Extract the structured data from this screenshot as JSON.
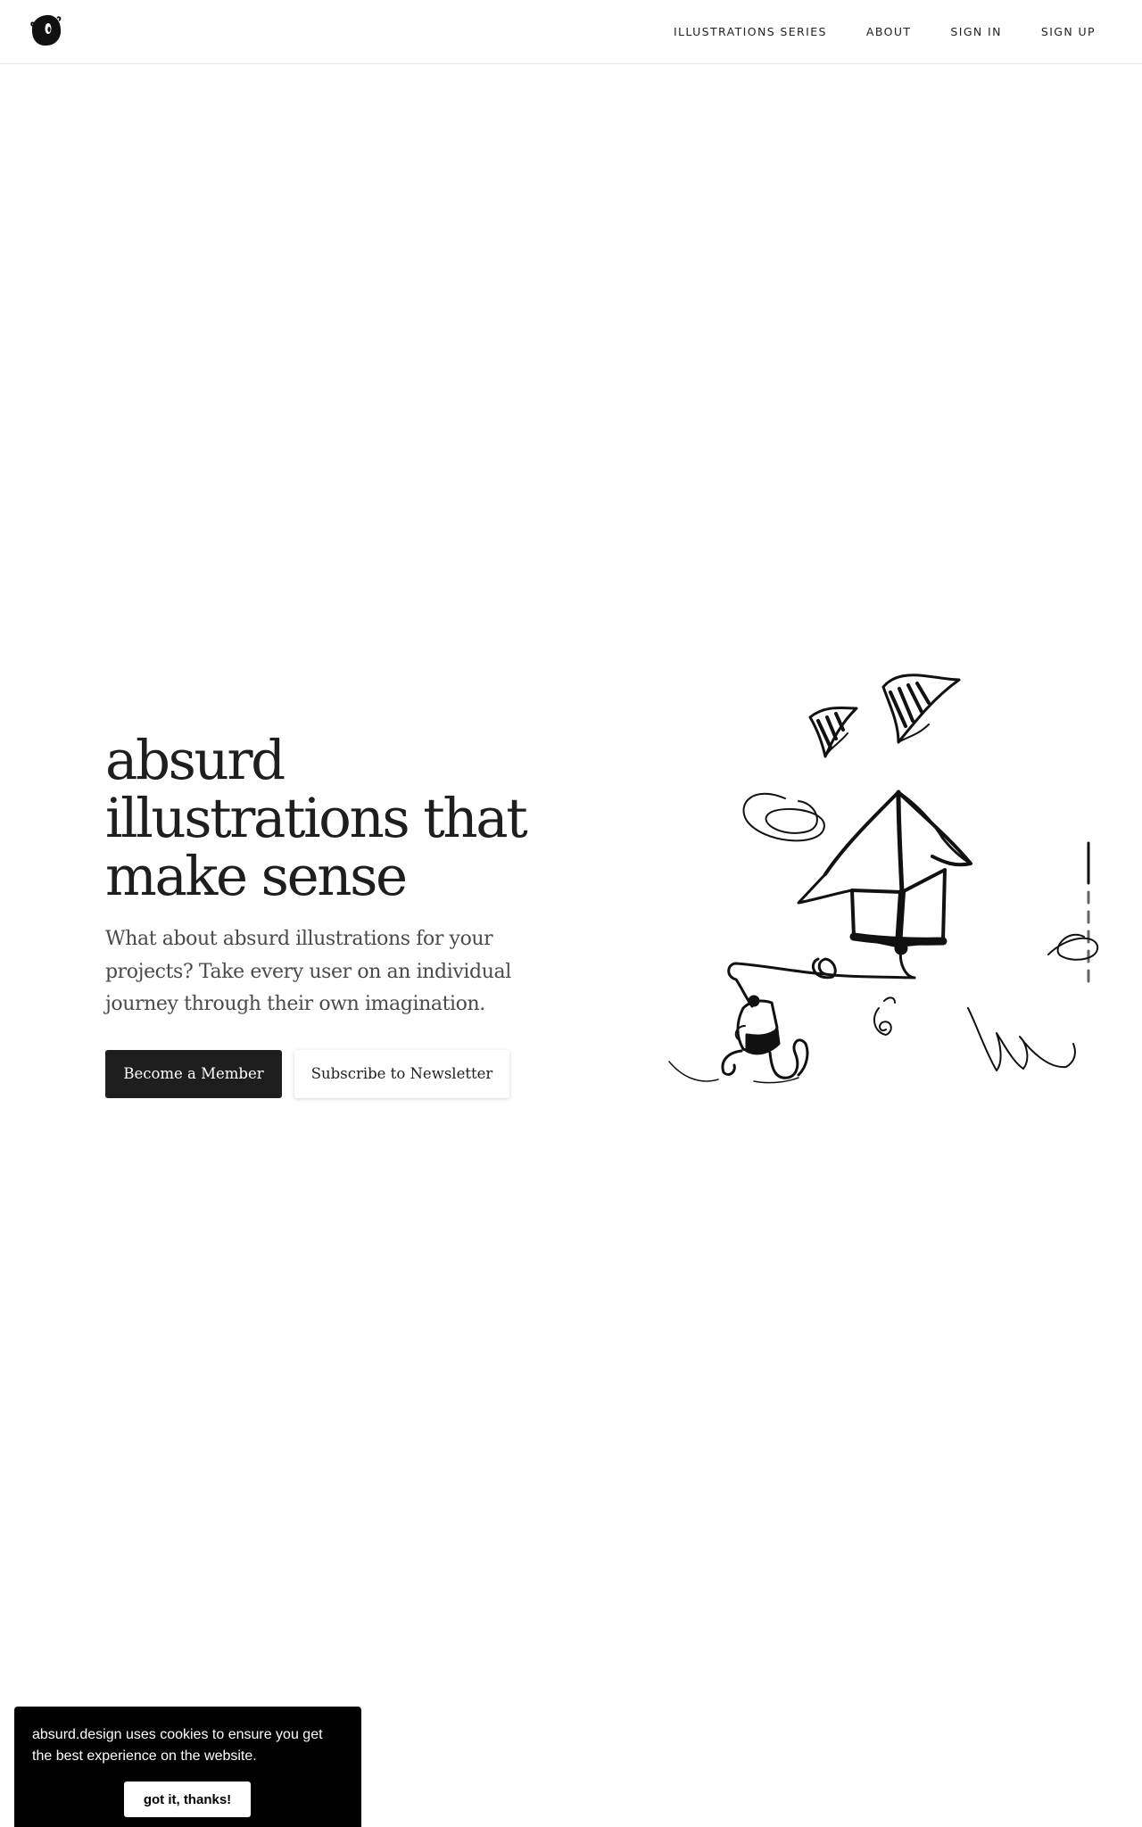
{
  "brand": {
    "logo_icon": "blob-logo-icon"
  },
  "nav": {
    "items": [
      {
        "label": "ILLUSTRATIONS SERIES"
      },
      {
        "label": "ABOUT"
      },
      {
        "label": "SIGN IN"
      },
      {
        "label": "SIGN UP"
      }
    ]
  },
  "hero": {
    "title_lines": [
      "absurd",
      "illustrations that",
      "make sense"
    ],
    "subtitle_lines": [
      "What about absurd illustrations for your",
      "projects? Take every user on an individual",
      "journey through their own imagination."
    ],
    "primary_button": "Become a Member",
    "secondary_button": "Subscribe to Newsletter"
  },
  "illustration": {
    "icon": "flying-house-illustration"
  },
  "cookie": {
    "text_lines": [
      "absurd.design uses cookies to ensure you get",
      "the best experience on the website."
    ],
    "button": "got it, thanks!"
  },
  "colors": {
    "ink": "#1e1e1e",
    "background": "#ffffff",
    "cookie_bg": "#000000"
  }
}
